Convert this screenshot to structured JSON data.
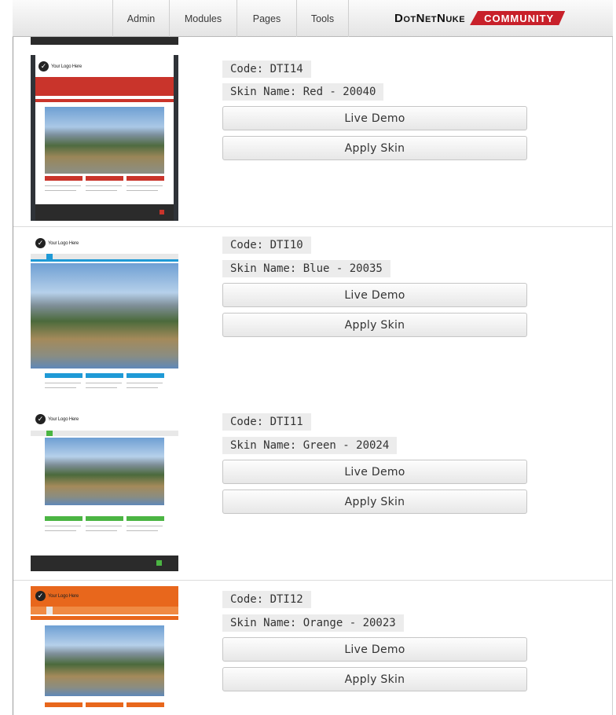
{
  "control_bar": {
    "menu": [
      "Admin",
      "Modules",
      "Pages",
      "Tools"
    ],
    "logo_text": "DotNetNuke",
    "logo_badge": "COMMUNITY"
  },
  "thumbnail": {
    "logo_text": "Your Logo Here"
  },
  "skins": [
    {
      "code": "Code: DTI14",
      "name": "Skin Name: Red - 20040",
      "live_demo": "Live Demo",
      "apply": "Apply Skin",
      "accent": "#c9342b"
    },
    {
      "code": "Code: DTI10",
      "name": "Skin Name: Blue - 20035",
      "live_demo": "Live Demo",
      "apply": "Apply Skin",
      "accent": "#1f9ad6"
    },
    {
      "code": "Code: DTI11",
      "name": "Skin Name: Green - 20024",
      "live_demo": "Live Demo",
      "apply": "Apply Skin",
      "accent": "#4bb543"
    },
    {
      "code": "Code: DTI12",
      "name": "Skin Name: Orange - 20023",
      "live_demo": "Live Demo",
      "apply": "Apply Skin",
      "accent": "#e8671c"
    }
  ]
}
